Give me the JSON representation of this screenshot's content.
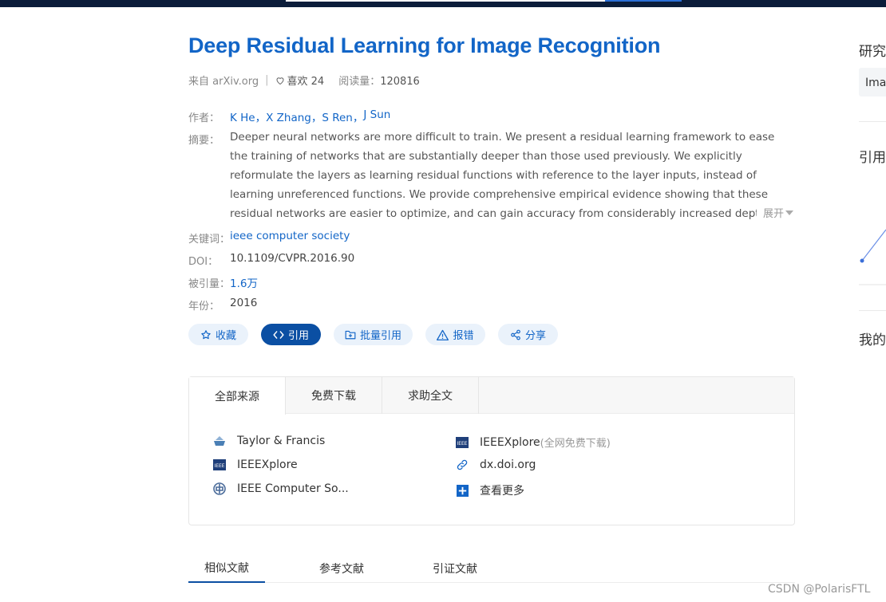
{
  "paper": {
    "title": "Deep Residual Learning for Image Recognition",
    "source_prefix": "来自 arXiv.org",
    "likes": "喜欢 24",
    "reads_label": "阅读量：",
    "reads_value": "120816",
    "authors_label": "作者：",
    "authors": [
      "K He，",
      "X Zhang，",
      "S Ren，",
      "J Sun"
    ],
    "abstract_label": "摘要：",
    "abstract": "Deeper neural networks are more difficult to train. We present a residual learning framework to ease the training of networks that are substantially deeper than those used previously. We explicitly reformulate the layers as learning residual functions with reference to the layer inputs, instead of learning unreferenced functions. We provide comprehensive empirical evidence showing that these residual networks are easier to optimize, and can gain accuracy from considerably increased depth. On the ImageNet dataset we evaluate residual nets with",
    "expand": "展开",
    "keywords_label": "关键词：",
    "keywords": "ieee computer society",
    "doi_label": "DOI：",
    "doi": "10.1109/CVPR.2016.90",
    "cited_label": "被引量：",
    "cited": "1.6万",
    "year_label": "年份：",
    "year": "2016"
  },
  "actions": {
    "collect": "收藏",
    "cite": "引用",
    "batch_cite": "批量引用",
    "report": "报错",
    "share": "分享"
  },
  "sources": {
    "tabs": [
      "全部来源",
      "免费下载",
      "求助全文"
    ],
    "left": [
      "Taylor & Francis",
      "IEEEXplore",
      "IEEE Computer So..."
    ],
    "right": [
      {
        "label": "IEEEXplore",
        "note": "(全网免费下载)"
      },
      {
        "label": "dx.doi.org",
        "note": ""
      },
      {
        "label": "查看更多",
        "note": ""
      }
    ]
  },
  "related_tabs": [
    "相似文献",
    "参考文献",
    "引证文献"
  ],
  "sidebar": {
    "heading1": "研究",
    "box_text": "Imag",
    "heading2": "引用",
    "heading3": "我的"
  },
  "watermark": "CSDN @PolarisFTL",
  "colors": {
    "accent": "#1265c7",
    "primary_button": "#0b4fa3",
    "topbar": "#0b1d3a"
  }
}
